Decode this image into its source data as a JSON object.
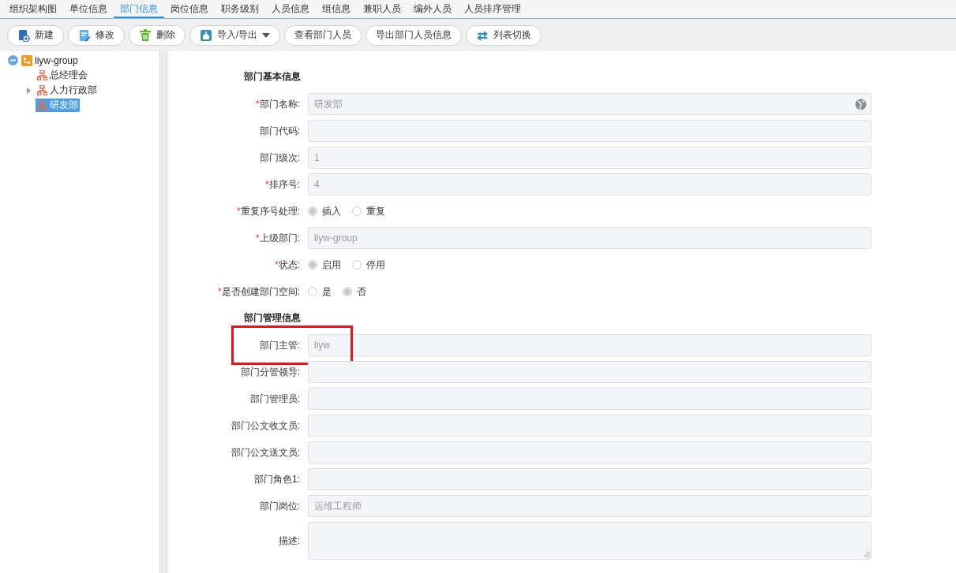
{
  "tabs": [
    {
      "label": "组织架构图",
      "selected": false
    },
    {
      "label": "单位信息",
      "selected": false
    },
    {
      "label": "部门信息",
      "selected": true
    },
    {
      "label": "岗位信息",
      "selected": false
    },
    {
      "label": "职务级别",
      "selected": false
    },
    {
      "label": "人员信息",
      "selected": false
    },
    {
      "label": "组信息",
      "selected": false
    },
    {
      "label": "兼职人员",
      "selected": false
    },
    {
      "label": "编外人员",
      "selected": false
    },
    {
      "label": "人员排序管理",
      "selected": false
    }
  ],
  "toolbar": [
    {
      "label": "新建",
      "kind": "new"
    },
    {
      "label": "修改",
      "kind": "edit"
    },
    {
      "label": "删除",
      "kind": "delete"
    },
    {
      "label": "导入/导出",
      "kind": "transfer",
      "dropdown": true
    },
    {
      "label": "查看部门人员",
      "kind": "plain"
    },
    {
      "label": "导出部门人员信息",
      "kind": "plain"
    },
    {
      "label": "列表切换",
      "kind": "switch"
    }
  ],
  "tree": [
    {
      "label": "liyw-group",
      "kind": "root",
      "expanded": true,
      "selected": false,
      "children": [
        {
          "label": "总经理会",
          "kind": "dept",
          "selected": false
        },
        {
          "label": "人力行政部",
          "kind": "dept",
          "expanded": false,
          "selected": false
        },
        {
          "label": "研发部",
          "kind": "dept",
          "selected": true
        }
      ]
    }
  ],
  "sections": [
    {
      "title": "部门基本信息",
      "fields": [
        {
          "kind": "text",
          "required_mark": "*",
          "label": "部门名称:",
          "value": "研发部",
          "globe": true
        },
        {
          "kind": "text",
          "label": "部门代码:"
        },
        {
          "kind": "text",
          "label": "部门级次:",
          "value": "1"
        },
        {
          "kind": "text",
          "required_mark": "*",
          "label": "排序号:",
          "value": "4"
        },
        {
          "kind": "radio",
          "required_mark": "*",
          "label": "重复序号处理:",
          "options": [
            {
              "label": "插入",
              "selected": true
            },
            {
              "label": "重复",
              "selected": false
            }
          ]
        },
        {
          "kind": "text",
          "required_mark": "*",
          "label": "上级部门:",
          "value": "liyw-group"
        },
        {
          "kind": "radio",
          "required_mark": "*",
          "label": "状态:",
          "options": [
            {
              "label": "启用",
              "selected": true
            },
            {
              "label": "停用",
              "selected": false
            }
          ]
        },
        {
          "kind": "radio",
          "required_mark": "*",
          "label": "是否创建部门空间:",
          "options": [
            {
              "label": "是",
              "selected": false
            },
            {
              "label": "否",
              "selected": true
            }
          ]
        }
      ]
    },
    {
      "title": "部门管理信息",
      "fields": [
        {
          "kind": "text",
          "label": "部门主管:",
          "value": "liyw",
          "highlighted": true
        },
        {
          "kind": "text",
          "label": "部门分管领导:"
        },
        {
          "kind": "text",
          "label": "部门管理员:"
        },
        {
          "kind": "text",
          "label": "部门公文收文员:"
        },
        {
          "kind": "text",
          "label": "部门公文送文员:"
        },
        {
          "kind": "text",
          "label": "部门角色1:"
        },
        {
          "kind": "text",
          "label": "部门岗位:",
          "value": "运维工程师"
        },
        {
          "kind": "textarea",
          "label": "描述:"
        }
      ]
    }
  ]
}
